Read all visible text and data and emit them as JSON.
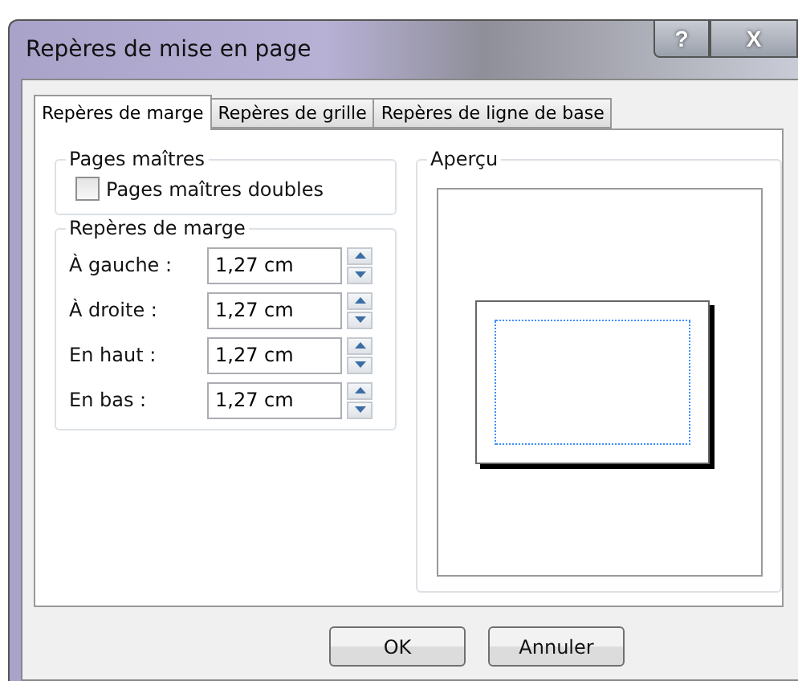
{
  "window": {
    "title": "Repères de mise en page",
    "help_button": "?",
    "close_button": "X"
  },
  "tabs": [
    {
      "label": "Repères de marge",
      "selected": true
    },
    {
      "label": "Repères de grille",
      "selected": false
    },
    {
      "label": "Repères de ligne de base",
      "selected": false
    }
  ],
  "master_pages": {
    "title": "Pages maîtres",
    "checkbox": {
      "label": "Pages maîtres doubles",
      "checked": false
    }
  },
  "margin_guides": {
    "title": "Repères de marge",
    "fields": [
      {
        "label": "À gauche :",
        "value": "1,27 cm"
      },
      {
        "label": "À droite :",
        "value": "1,27 cm"
      },
      {
        "label": "En haut :",
        "value": "1,27 cm"
      },
      {
        "label": "En bas :",
        "value": "1,27 cm"
      }
    ]
  },
  "preview": {
    "title": "Aperçu"
  },
  "buttons": [
    "OK",
    "Annuler"
  ]
}
